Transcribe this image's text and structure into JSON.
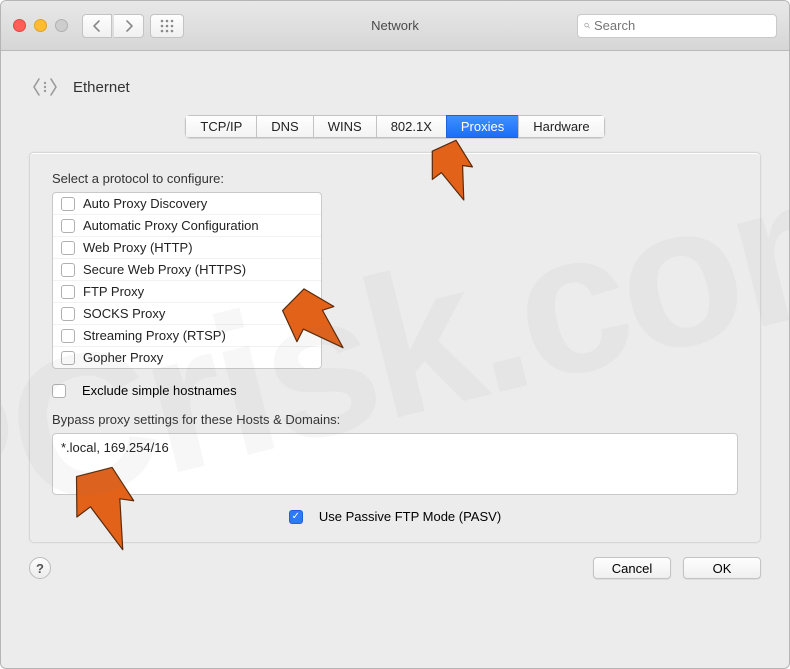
{
  "titlebar": {
    "title": "Network",
    "search_placeholder": "Search"
  },
  "header": {
    "interface": "Ethernet"
  },
  "tabs": [
    {
      "label": "TCP/IP",
      "active": false
    },
    {
      "label": "DNS",
      "active": false
    },
    {
      "label": "WINS",
      "active": false
    },
    {
      "label": "802.1X",
      "active": false
    },
    {
      "label": "Proxies",
      "active": true
    },
    {
      "label": "Hardware",
      "active": false
    }
  ],
  "panel": {
    "select_label": "Select a protocol to configure:",
    "protocols": [
      {
        "label": "Auto Proxy Discovery",
        "checked": false
      },
      {
        "label": "Automatic Proxy Configuration",
        "checked": false
      },
      {
        "label": "Web Proxy (HTTP)",
        "checked": false
      },
      {
        "label": "Secure Web Proxy (HTTPS)",
        "checked": false
      },
      {
        "label": "FTP Proxy",
        "checked": false
      },
      {
        "label": "SOCKS Proxy",
        "checked": false
      },
      {
        "label": "Streaming Proxy (RTSP)",
        "checked": false
      },
      {
        "label": "Gopher Proxy",
        "checked": false
      }
    ],
    "exclude_label": "Exclude simple hostnames",
    "exclude_checked": false,
    "bypass_label": "Bypass proxy settings for these Hosts & Domains:",
    "bypass_value": "*.local, 169.254/16",
    "pasv_label": "Use Passive FTP Mode (PASV)",
    "pasv_checked": true
  },
  "footer": {
    "help": "?",
    "cancel": "Cancel",
    "ok": "OK"
  },
  "watermark": "PCrisk.com",
  "annotations": {
    "arrow_color": "#e2621a"
  }
}
